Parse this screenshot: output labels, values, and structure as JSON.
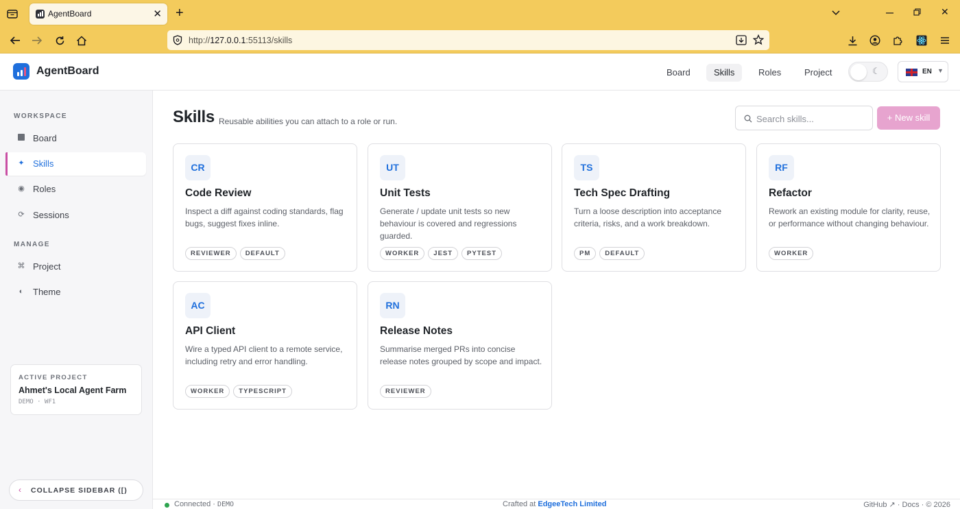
{
  "browser": {
    "tab_title": "AgentBoard",
    "url_prefix": "http://",
    "url_host": "127.0.0.1",
    "url_rest": ":55113/skills"
  },
  "header": {
    "brand": "AgentBoard",
    "nav": [
      "Board",
      "Skills",
      "Roles",
      "Project"
    ],
    "active_nav": "Skills",
    "language": "EN"
  },
  "sidebar": {
    "workspace_heading": "WORKSPACE",
    "workspace_items": [
      {
        "label": "Board",
        "icon": "grid-icon"
      },
      {
        "label": "Skills",
        "icon": "sparkle-icon"
      },
      {
        "label": "Roles",
        "icon": "user-icon"
      },
      {
        "label": "Sessions",
        "icon": "refresh-icon"
      }
    ],
    "manage_heading": "MANAGE",
    "manage_items": [
      {
        "label": "Project",
        "icon": "command-icon"
      },
      {
        "label": "Theme",
        "icon": "contrast-icon"
      }
    ],
    "active_project_label": "ACTIVE PROJECT",
    "project_name": "Ahmet's Local Agent Farm",
    "project_meta": "DEMO · WF1",
    "collapse_label": "COLLAPSE SIDEBAR ([)"
  },
  "main": {
    "title": "Skills",
    "subtitle": "Reusable abilities you can attach to a role or run.",
    "search_placeholder": "Search skills...",
    "new_button": "+ New skill",
    "cards": [
      {
        "abbr": "CR",
        "title": "Code Review",
        "desc": "Inspect a diff against coding standards, flag bugs, suggest fixes inline.",
        "tags": [
          "REVIEWER",
          "DEFAULT"
        ]
      },
      {
        "abbr": "UT",
        "title": "Unit Tests",
        "desc": "Generate / update unit tests so new behaviour is covered and regressions guarded.",
        "tags": [
          "WORKER",
          "JEST",
          "PYTEST"
        ]
      },
      {
        "abbr": "TS",
        "title": "Tech Spec Drafting",
        "desc": "Turn a loose description into acceptance criteria, risks, and a work breakdown.",
        "tags": [
          "PM",
          "DEFAULT"
        ]
      },
      {
        "abbr": "RF",
        "title": "Refactor",
        "desc": "Rework an existing module for clarity, reuse, or performance without changing behaviour.",
        "tags": [
          "WORKER"
        ]
      },
      {
        "abbr": "AC",
        "title": "API Client",
        "desc": "Wire a typed API client to a remote service, including retry and error handling.",
        "tags": [
          "WORKER",
          "TYPESCRIPT"
        ]
      },
      {
        "abbr": "RN",
        "title": "Release Notes",
        "desc": "Summarise merged PRs into concise release notes grouped by scope and impact.",
        "tags": [
          "REVIEWER"
        ]
      }
    ]
  },
  "footer": {
    "status": "Connected",
    "mode": "DEMO",
    "crafted_prefix": "Crafted at",
    "company": "EdgeeTech Limited",
    "github": "GitHub ↗",
    "docs": "Docs",
    "copyright": "© 2026"
  }
}
